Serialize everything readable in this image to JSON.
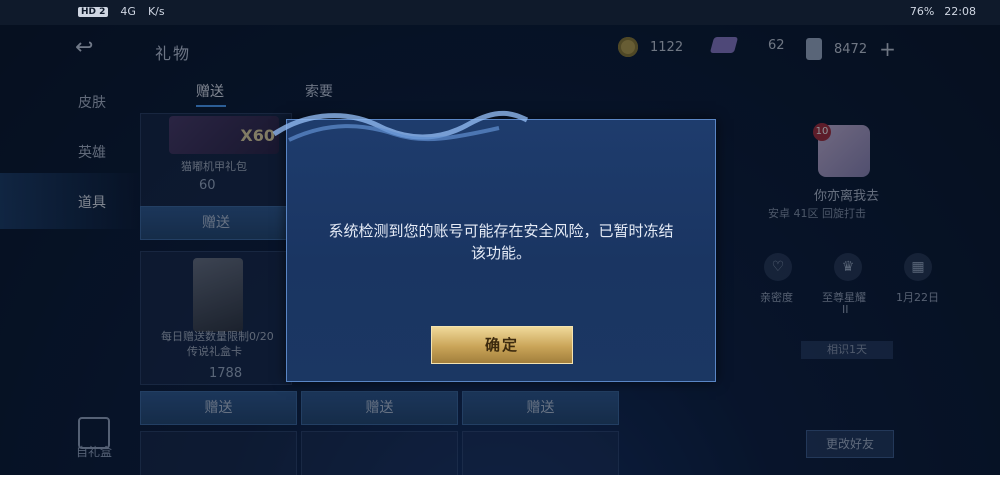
{
  "status_bar": {
    "hd_badge": "HD 2",
    "signal": "4G",
    "speed": "K/s",
    "battery": "76%",
    "time": "22:08"
  },
  "header": {
    "back_label": "↩",
    "title": "礼物",
    "resources": [
      {
        "icon": "coin-icon",
        "value": "1122"
      },
      {
        "icon": "gem-icon",
        "value": "62"
      },
      {
        "icon": "card-icon",
        "value": "8472"
      }
    ],
    "add_label": "+"
  },
  "sidebar": {
    "items": [
      {
        "label": "皮肤"
      },
      {
        "label": "英雄"
      },
      {
        "label": "道具"
      }
    ],
    "gift_box_label": "自礼盒"
  },
  "tabs": [
    {
      "label": "赠送"
    },
    {
      "label": "索要"
    }
  ],
  "items": [
    {
      "name": "猫嘟机甲礼包",
      "price": "60",
      "qty": "X60"
    },
    {
      "name": "每日赠送数量限制0/20",
      "name2": "传说礼盒卡",
      "price": "1788"
    }
  ],
  "send_label": "赠送",
  "friend": {
    "level": "10",
    "name": "你亦离我去",
    "info": "安卓 41区 回旋打击",
    "stats": [
      {
        "icon": "heart-icon",
        "label": "亲密度"
      },
      {
        "icon": "crown-icon",
        "label": "至尊星耀",
        "sub": "II"
      },
      {
        "icon": "cake-icon",
        "label": "1月22日"
      }
    ],
    "pill": "相识1天",
    "change_label": "更改好友"
  },
  "modal": {
    "message_line1": "系统检测到您的账号可能存在安全风险，已暂时冻结",
    "message_line2": "该功能。",
    "confirm_label": "确定"
  },
  "colors": {
    "accent": "#4ea2ff",
    "confirm_gold": "#c9a458",
    "modal_bg": "#1e3c6d"
  }
}
